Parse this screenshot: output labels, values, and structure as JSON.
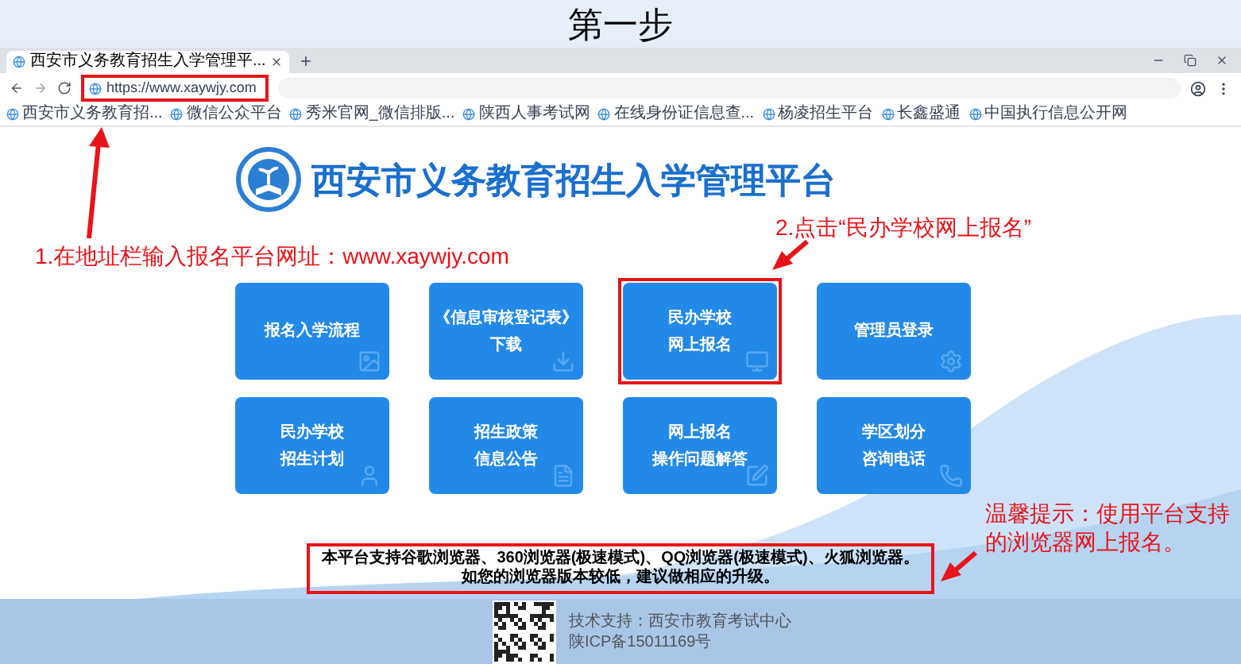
{
  "heading": "第一步",
  "browser": {
    "tab": {
      "title": "西安市义务教育招生入学管理平..."
    },
    "address": {
      "url": "https://www.xaywjy.com",
      "highlighted": true
    },
    "bookmarks": [
      {
        "label": "西安市义务教育招..."
      },
      {
        "label": "微信公众平台"
      },
      {
        "label": "秀米官网_微信排版..."
      },
      {
        "label": "陕西人事考试网"
      },
      {
        "label": "在线身份证信息查..."
      },
      {
        "label": "杨凌招生平台"
      },
      {
        "label": "长鑫盛通"
      },
      {
        "label": "中国执行信息公开网"
      }
    ]
  },
  "page": {
    "title": "西安市义务教育招生入学管理平台",
    "tiles": [
      {
        "lines": [
          "报名入学流程"
        ],
        "kind": "image",
        "highlighted": false
      },
      {
        "lines": [
          "《信息审核登记表》",
          "下载"
        ],
        "kind": "download",
        "highlighted": false
      },
      {
        "lines": [
          "民办学校",
          "网上报名"
        ],
        "kind": "monitor",
        "highlighted": true
      },
      {
        "lines": [
          "管理员登录"
        ],
        "kind": "gear",
        "highlighted": false
      },
      {
        "lines": [
          "民办学校",
          "招生计划"
        ],
        "kind": "person",
        "highlighted": false
      },
      {
        "lines": [
          "招生政策",
          "信息公告"
        ],
        "kind": "document",
        "highlighted": false
      },
      {
        "lines": [
          "网上报名",
          "操作问题解答"
        ],
        "kind": "edit",
        "highlighted": false
      },
      {
        "lines": [
          "学区划分",
          "咨询电话"
        ],
        "kind": "phone",
        "highlighted": false
      }
    ],
    "notice": {
      "lines": [
        "本平台支持谷歌浏览器、360浏览器(极速模式)、QQ浏览器(极速模式)、火狐浏览器。",
        "如您的浏览器版本较低，建议做相应的升级。"
      ],
      "highlighted": true
    },
    "footer": {
      "support": "技术支持：西安市教育考试中心",
      "icp": "陕ICP备15011169号"
    }
  },
  "annotations": [
    {
      "text": "1.在地址栏输入报名平台网址：www.xaywjy.com"
    },
    {
      "text": "2.点击“民办学校网上报名”"
    },
    {
      "text": "温馨提示：使用平台支持的浏览器网上报名。"
    }
  ]
}
